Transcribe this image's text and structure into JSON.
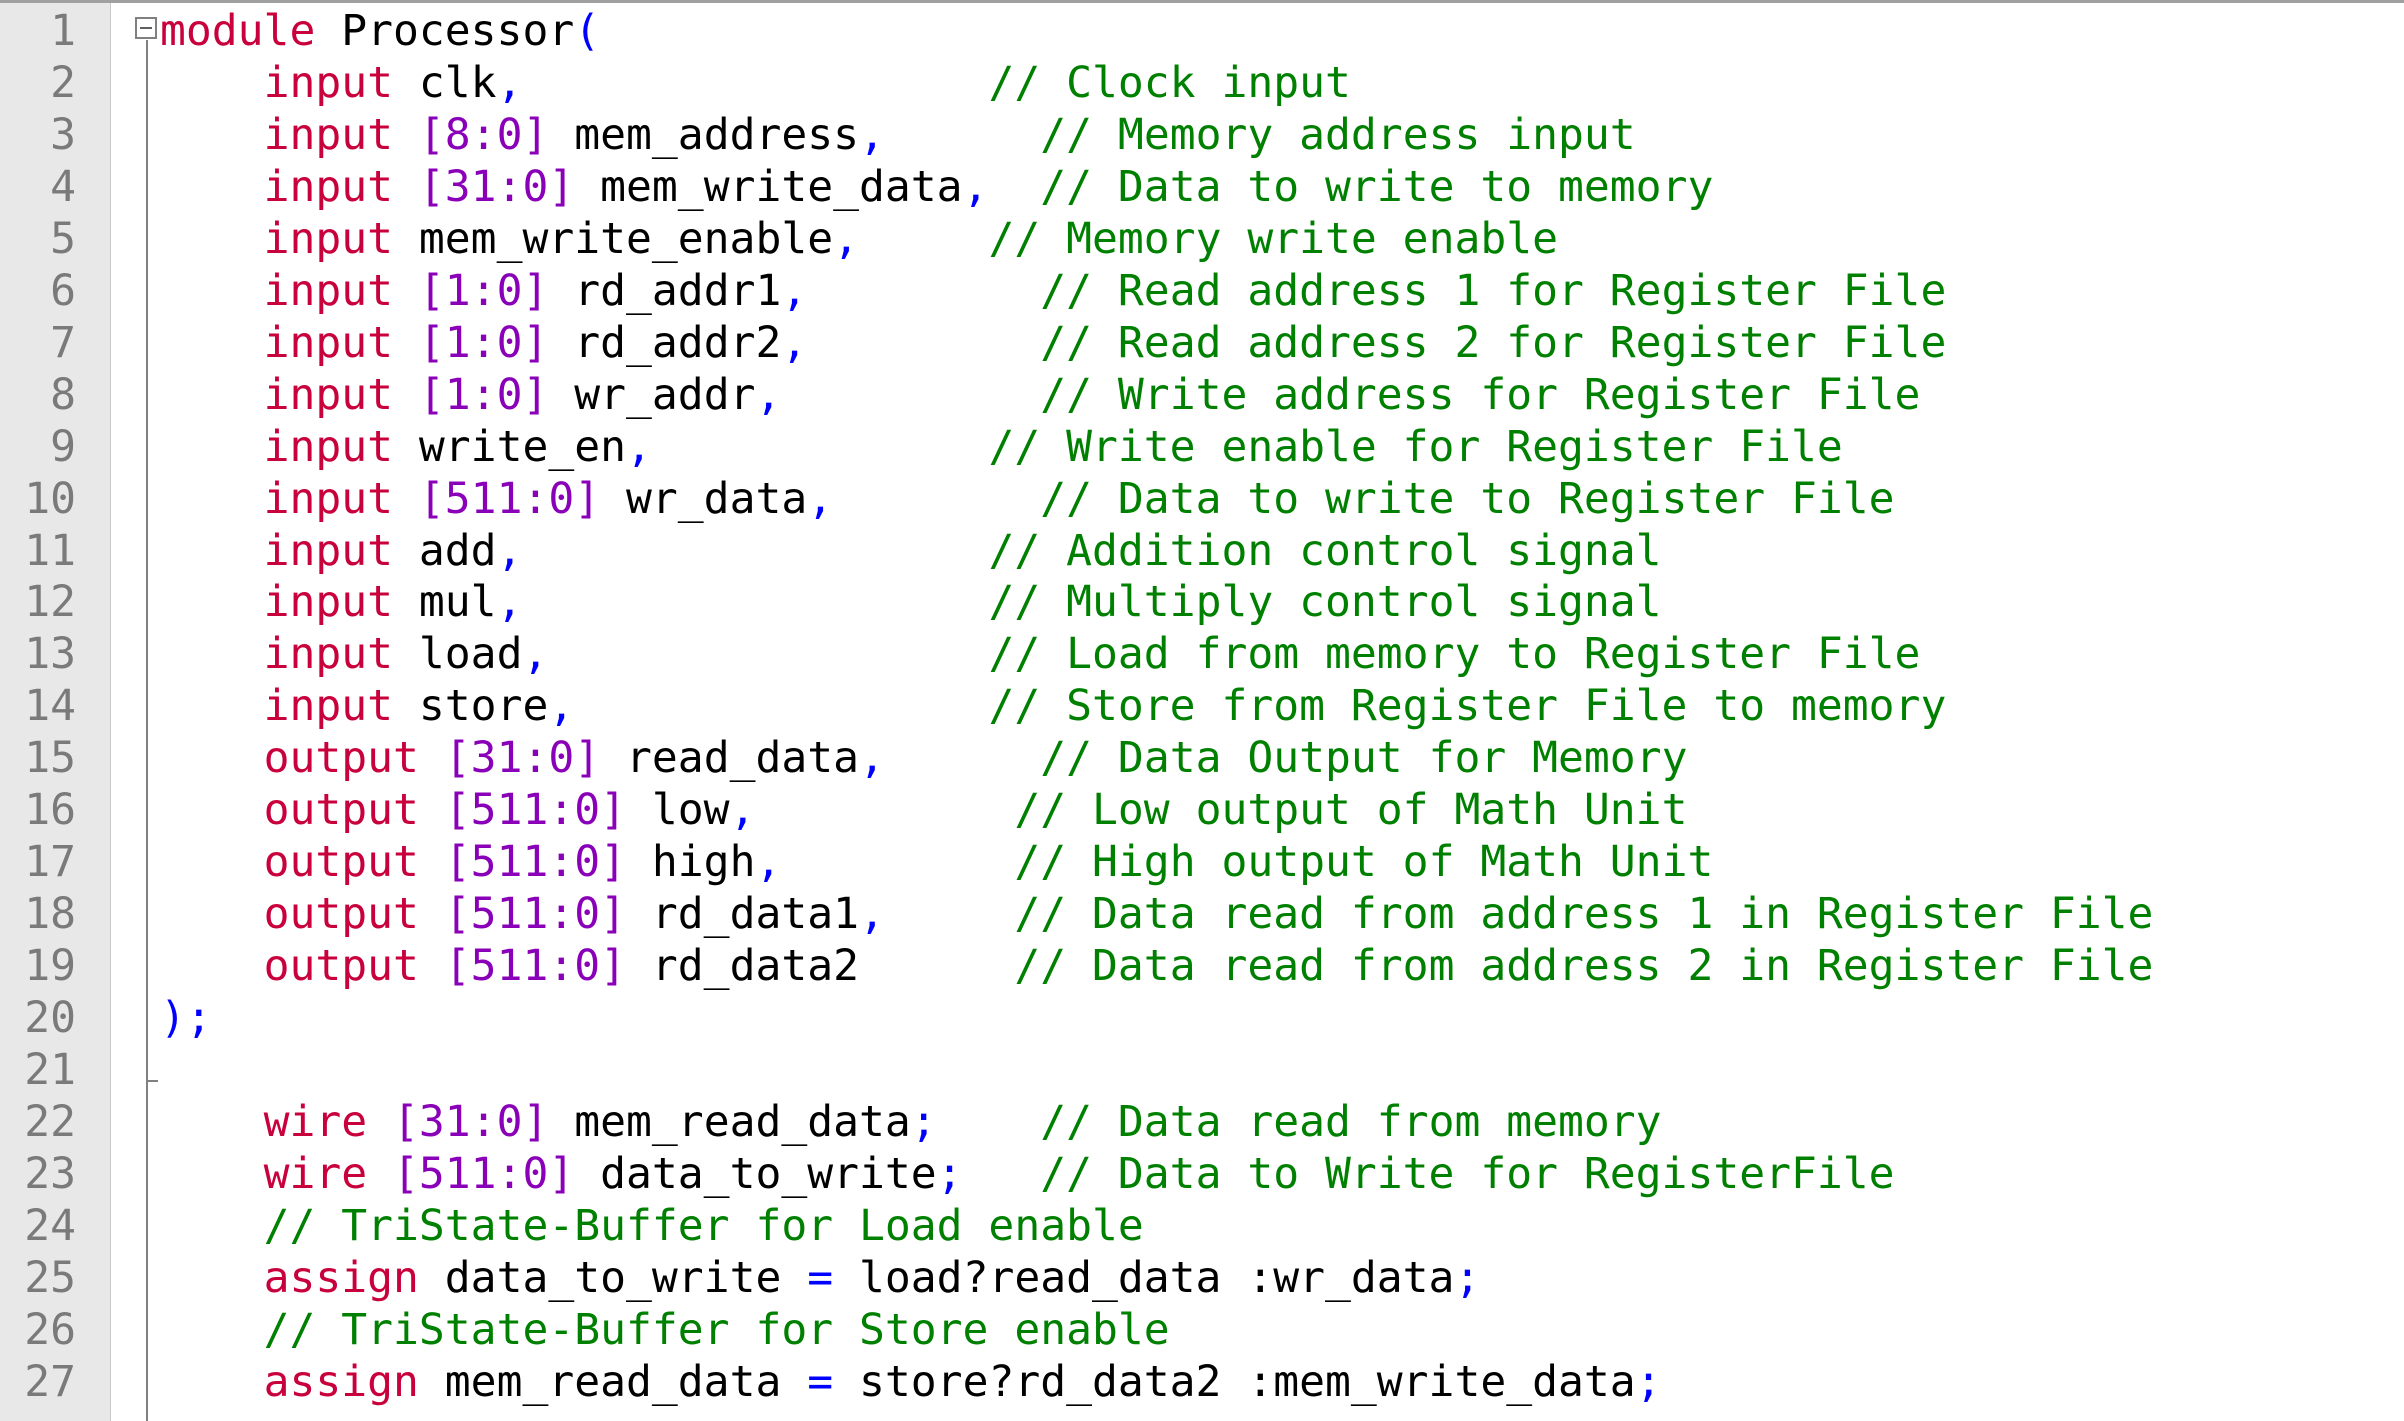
{
  "editor": {
    "lines": [
      {
        "n": "1",
        "segments": [
          {
            "c": "kw",
            "t": "module"
          },
          {
            "c": "id",
            "t": " Processor"
          },
          {
            "c": "op",
            "t": "("
          }
        ]
      },
      {
        "n": "2",
        "segments": [
          {
            "c": "id",
            "t": "    "
          },
          {
            "c": "kw",
            "t": "input"
          },
          {
            "c": "id",
            "t": " clk"
          },
          {
            "c": "op",
            "t": ","
          },
          {
            "c": "id",
            "t": "                  "
          },
          {
            "c": "cm",
            "t": "// Clock input"
          }
        ]
      },
      {
        "n": "3",
        "segments": [
          {
            "c": "id",
            "t": "    "
          },
          {
            "c": "kw",
            "t": "input"
          },
          {
            "c": "id",
            "t": " "
          },
          {
            "c": "rng",
            "t": "[8:0]"
          },
          {
            "c": "id",
            "t": " mem_address"
          },
          {
            "c": "op",
            "t": ","
          },
          {
            "c": "id",
            "t": "      "
          },
          {
            "c": "cm",
            "t": "// Memory address input"
          }
        ]
      },
      {
        "n": "4",
        "segments": [
          {
            "c": "id",
            "t": "    "
          },
          {
            "c": "kw",
            "t": "input"
          },
          {
            "c": "id",
            "t": " "
          },
          {
            "c": "rng",
            "t": "[31:0]"
          },
          {
            "c": "id",
            "t": " mem_write_data"
          },
          {
            "c": "op",
            "t": ","
          },
          {
            "c": "id",
            "t": "  "
          },
          {
            "c": "cm",
            "t": "// Data to write to memory"
          }
        ]
      },
      {
        "n": "5",
        "segments": [
          {
            "c": "id",
            "t": "    "
          },
          {
            "c": "kw",
            "t": "input"
          },
          {
            "c": "id",
            "t": " mem_write_enable"
          },
          {
            "c": "op",
            "t": ","
          },
          {
            "c": "id",
            "t": "     "
          },
          {
            "c": "cm",
            "t": "// Memory write enable"
          }
        ]
      },
      {
        "n": "6",
        "segments": [
          {
            "c": "id",
            "t": "    "
          },
          {
            "c": "kw",
            "t": "input"
          },
          {
            "c": "id",
            "t": " "
          },
          {
            "c": "rng",
            "t": "[1:0]"
          },
          {
            "c": "id",
            "t": " rd_addr1"
          },
          {
            "c": "op",
            "t": ","
          },
          {
            "c": "id",
            "t": "         "
          },
          {
            "c": "cm",
            "t": "// Read address 1 for Register File"
          }
        ]
      },
      {
        "n": "7",
        "segments": [
          {
            "c": "id",
            "t": "    "
          },
          {
            "c": "kw",
            "t": "input"
          },
          {
            "c": "id",
            "t": " "
          },
          {
            "c": "rng",
            "t": "[1:0]"
          },
          {
            "c": "id",
            "t": " rd_addr2"
          },
          {
            "c": "op",
            "t": ","
          },
          {
            "c": "id",
            "t": "         "
          },
          {
            "c": "cm",
            "t": "// Read address 2 for Register File"
          }
        ]
      },
      {
        "n": "8",
        "segments": [
          {
            "c": "id",
            "t": "    "
          },
          {
            "c": "kw",
            "t": "input"
          },
          {
            "c": "id",
            "t": " "
          },
          {
            "c": "rng",
            "t": "[1:0]"
          },
          {
            "c": "id",
            "t": " wr_addr"
          },
          {
            "c": "op",
            "t": ","
          },
          {
            "c": "id",
            "t": "          "
          },
          {
            "c": "cm",
            "t": "// Write address for Register File"
          }
        ]
      },
      {
        "n": "9",
        "segments": [
          {
            "c": "id",
            "t": "    "
          },
          {
            "c": "kw",
            "t": "input"
          },
          {
            "c": "id",
            "t": " write_en"
          },
          {
            "c": "op",
            "t": ","
          },
          {
            "c": "id",
            "t": "             "
          },
          {
            "c": "cm",
            "t": "// Write enable for Register File"
          }
        ]
      },
      {
        "n": "10",
        "segments": [
          {
            "c": "id",
            "t": "    "
          },
          {
            "c": "kw",
            "t": "input"
          },
          {
            "c": "id",
            "t": " "
          },
          {
            "c": "rng",
            "t": "[511:0]"
          },
          {
            "c": "id",
            "t": " wr_data"
          },
          {
            "c": "op",
            "t": ","
          },
          {
            "c": "id",
            "t": "        "
          },
          {
            "c": "cm",
            "t": "// Data to write to Register File"
          }
        ]
      },
      {
        "n": "11",
        "segments": [
          {
            "c": "id",
            "t": "    "
          },
          {
            "c": "kw",
            "t": "input"
          },
          {
            "c": "id",
            "t": " add"
          },
          {
            "c": "op",
            "t": ","
          },
          {
            "c": "id",
            "t": "                  "
          },
          {
            "c": "cm",
            "t": "// Addition control signal"
          }
        ]
      },
      {
        "n": "12",
        "segments": [
          {
            "c": "id",
            "t": "    "
          },
          {
            "c": "kw",
            "t": "input"
          },
          {
            "c": "id",
            "t": " mul"
          },
          {
            "c": "op",
            "t": ","
          },
          {
            "c": "id",
            "t": "                  "
          },
          {
            "c": "cm",
            "t": "// Multiply control signal"
          }
        ]
      },
      {
        "n": "13",
        "segments": [
          {
            "c": "id",
            "t": "    "
          },
          {
            "c": "kw",
            "t": "input"
          },
          {
            "c": "id",
            "t": " load"
          },
          {
            "c": "op",
            "t": ","
          },
          {
            "c": "id",
            "t": "                 "
          },
          {
            "c": "cm",
            "t": "// Load from memory to Register File"
          }
        ]
      },
      {
        "n": "14",
        "segments": [
          {
            "c": "id",
            "t": "    "
          },
          {
            "c": "kw",
            "t": "input"
          },
          {
            "c": "id",
            "t": " store"
          },
          {
            "c": "op",
            "t": ","
          },
          {
            "c": "id",
            "t": "                "
          },
          {
            "c": "cm",
            "t": "// Store from Register File to memory"
          }
        ]
      },
      {
        "n": "15",
        "segments": [
          {
            "c": "id",
            "t": "    "
          },
          {
            "c": "kw",
            "t": "output"
          },
          {
            "c": "id",
            "t": " "
          },
          {
            "c": "rng",
            "t": "[31:0]"
          },
          {
            "c": "id",
            "t": " read_data"
          },
          {
            "c": "op",
            "t": ","
          },
          {
            "c": "id",
            "t": "      "
          },
          {
            "c": "cm",
            "t": "// Data Output for Memory"
          }
        ]
      },
      {
        "n": "16",
        "segments": [
          {
            "c": "id",
            "t": "    "
          },
          {
            "c": "kw",
            "t": "output"
          },
          {
            "c": "id",
            "t": " "
          },
          {
            "c": "rng",
            "t": "[511:0]"
          },
          {
            "c": "id",
            "t": " low"
          },
          {
            "c": "op",
            "t": ","
          },
          {
            "c": "id",
            "t": "          "
          },
          {
            "c": "cm",
            "t": "// Low output of Math Unit"
          }
        ]
      },
      {
        "n": "17",
        "segments": [
          {
            "c": "id",
            "t": "    "
          },
          {
            "c": "kw",
            "t": "output"
          },
          {
            "c": "id",
            "t": " "
          },
          {
            "c": "rng",
            "t": "[511:0]"
          },
          {
            "c": "id",
            "t": " high"
          },
          {
            "c": "op",
            "t": ","
          },
          {
            "c": "id",
            "t": "         "
          },
          {
            "c": "cm",
            "t": "// High output of Math Unit"
          }
        ]
      },
      {
        "n": "18",
        "segments": [
          {
            "c": "id",
            "t": "    "
          },
          {
            "c": "kw",
            "t": "output"
          },
          {
            "c": "id",
            "t": " "
          },
          {
            "c": "rng",
            "t": "[511:0]"
          },
          {
            "c": "id",
            "t": " rd_data1"
          },
          {
            "c": "op",
            "t": ","
          },
          {
            "c": "id",
            "t": "     "
          },
          {
            "c": "cm",
            "t": "// Data read from address 1 in Register File"
          }
        ]
      },
      {
        "n": "19",
        "segments": [
          {
            "c": "id",
            "t": "    "
          },
          {
            "c": "kw",
            "t": "output"
          },
          {
            "c": "id",
            "t": " "
          },
          {
            "c": "rng",
            "t": "[511:0]"
          },
          {
            "c": "id",
            "t": " rd_data2"
          },
          {
            "c": "id",
            "t": "      "
          },
          {
            "c": "cm",
            "t": "// Data read from address 2 in Register File"
          }
        ]
      },
      {
        "n": "20",
        "segments": [
          {
            "c": "op",
            "t": ");"
          }
        ]
      },
      {
        "n": "21",
        "segments": []
      },
      {
        "n": "22",
        "segments": [
          {
            "c": "id",
            "t": "    "
          },
          {
            "c": "kw",
            "t": "wire"
          },
          {
            "c": "id",
            "t": " "
          },
          {
            "c": "rng",
            "t": "[31:0]"
          },
          {
            "c": "id",
            "t": " mem_read_data"
          },
          {
            "c": "op",
            "t": ";"
          },
          {
            "c": "id",
            "t": "    "
          },
          {
            "c": "cm",
            "t": "// Data read from memory"
          }
        ]
      },
      {
        "n": "23",
        "segments": [
          {
            "c": "id",
            "t": "    "
          },
          {
            "c": "kw",
            "t": "wire"
          },
          {
            "c": "id",
            "t": " "
          },
          {
            "c": "rng",
            "t": "[511:0]"
          },
          {
            "c": "id",
            "t": " data_to_write"
          },
          {
            "c": "op",
            "t": ";"
          },
          {
            "c": "id",
            "t": "   "
          },
          {
            "c": "cm",
            "t": "// Data to Write for RegisterFile"
          }
        ]
      },
      {
        "n": "24",
        "segments": [
          {
            "c": "id",
            "t": "    "
          },
          {
            "c": "cm",
            "t": "// TriState-Buffer for Load enable"
          }
        ]
      },
      {
        "n": "25",
        "segments": [
          {
            "c": "id",
            "t": "    "
          },
          {
            "c": "kw",
            "t": "assign"
          },
          {
            "c": "id",
            "t": " data_to_write "
          },
          {
            "c": "op",
            "t": "="
          },
          {
            "c": "id",
            "t": " load?read_data :wr_data"
          },
          {
            "c": "op",
            "t": ";"
          }
        ]
      },
      {
        "n": "26",
        "segments": [
          {
            "c": "id",
            "t": "    "
          },
          {
            "c": "cm",
            "t": "// TriState-Buffer for Store enable"
          }
        ]
      },
      {
        "n": "27",
        "segments": [
          {
            "c": "id",
            "t": "    "
          },
          {
            "c": "kw",
            "t": "assign"
          },
          {
            "c": "id",
            "t": " mem_read_data "
          },
          {
            "c": "op",
            "t": "="
          },
          {
            "c": "id",
            "t": " store?rd_data2 :mem_write_data"
          },
          {
            "c": "op",
            "t": ";"
          }
        ]
      }
    ]
  }
}
